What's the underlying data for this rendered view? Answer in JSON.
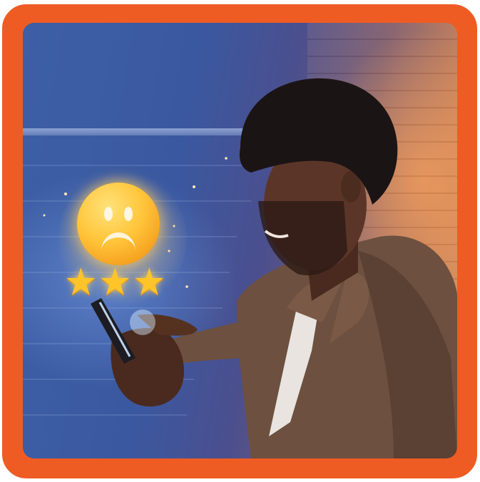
{
  "image": {
    "frame_color": "#ee5c24",
    "subject": "man-with-smartphone",
    "overlay": {
      "emoji": "sad-face-icon",
      "stars": [
        "star-icon",
        "star-icon",
        "star-icon"
      ],
      "rating_stars": 3
    },
    "palette": {
      "wall_blue": "#3d5fa6",
      "warm_light": "#d58a5a",
      "shirt": "#6b4f3d",
      "skin": "#5a3426",
      "hair": "#1b1414"
    }
  }
}
